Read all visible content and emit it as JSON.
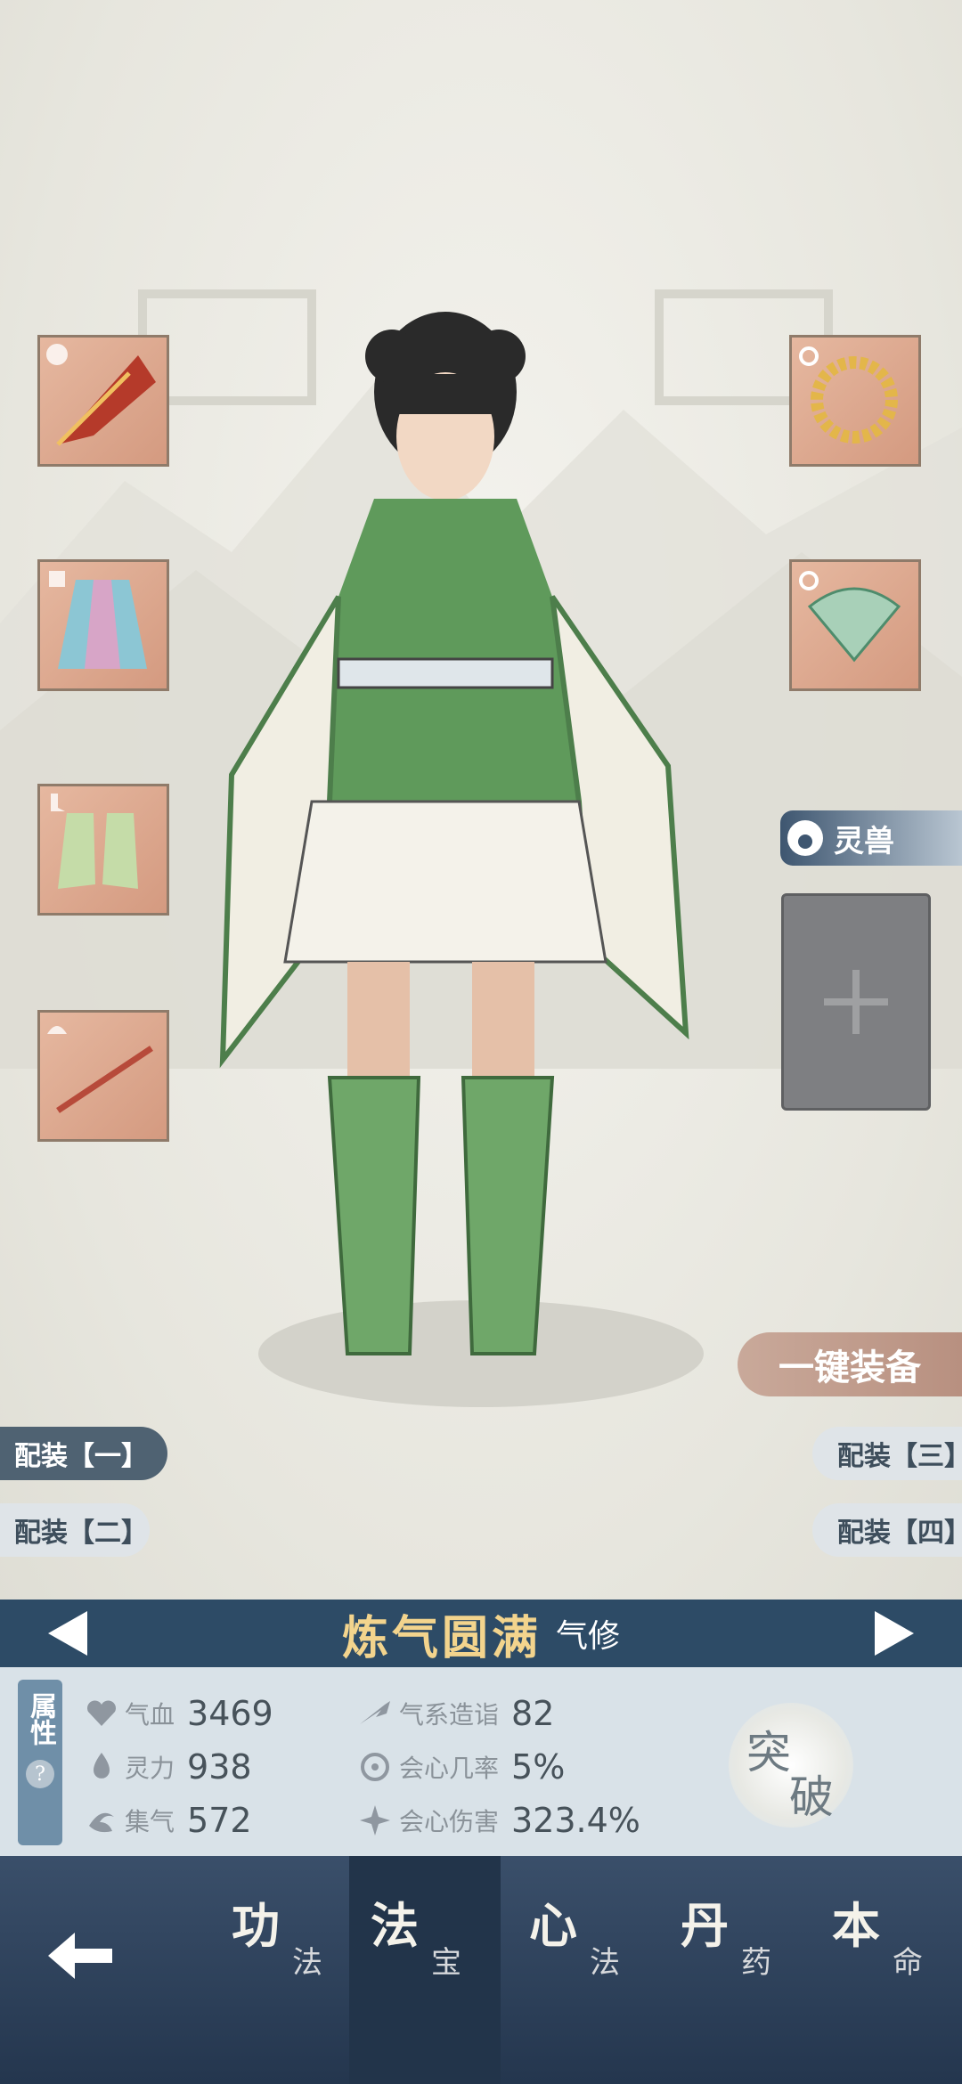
{
  "pet": {
    "label": "灵兽"
  },
  "one_click_equip": "一键装备",
  "loadouts": [
    "配装【一】",
    "配装【二】",
    "配装【三】",
    "配装【四】"
  ],
  "realm": {
    "title": "炼气圆满",
    "subtitle": "气修"
  },
  "attributes": {
    "tab_label": "属性",
    "help": "?",
    "left": [
      {
        "icon": "heart-icon",
        "label": "气血",
        "value": "3469"
      },
      {
        "icon": "drop-icon",
        "label": "灵力",
        "value": "938"
      },
      {
        "icon": "swirl-icon",
        "label": "集气",
        "value": "572"
      }
    ],
    "right": [
      {
        "icon": "wind-icon",
        "label": "气系造诣",
        "value": "82"
      },
      {
        "icon": "crit-rate-icon",
        "label": "会心几率",
        "value": "5%"
      },
      {
        "icon": "crit-damage-icon",
        "label": "会心伤害",
        "value": "323.4%"
      }
    ],
    "breakthrough": [
      "突",
      "破"
    ]
  },
  "nav": {
    "back": "back",
    "tabs": [
      {
        "big": "功",
        "small": "法"
      },
      {
        "big": "法",
        "small": "宝",
        "active": true
      },
      {
        "big": "心",
        "small": "法"
      },
      {
        "big": "丹",
        "small": "药"
      },
      {
        "big": "本",
        "small": "命"
      }
    ]
  }
}
